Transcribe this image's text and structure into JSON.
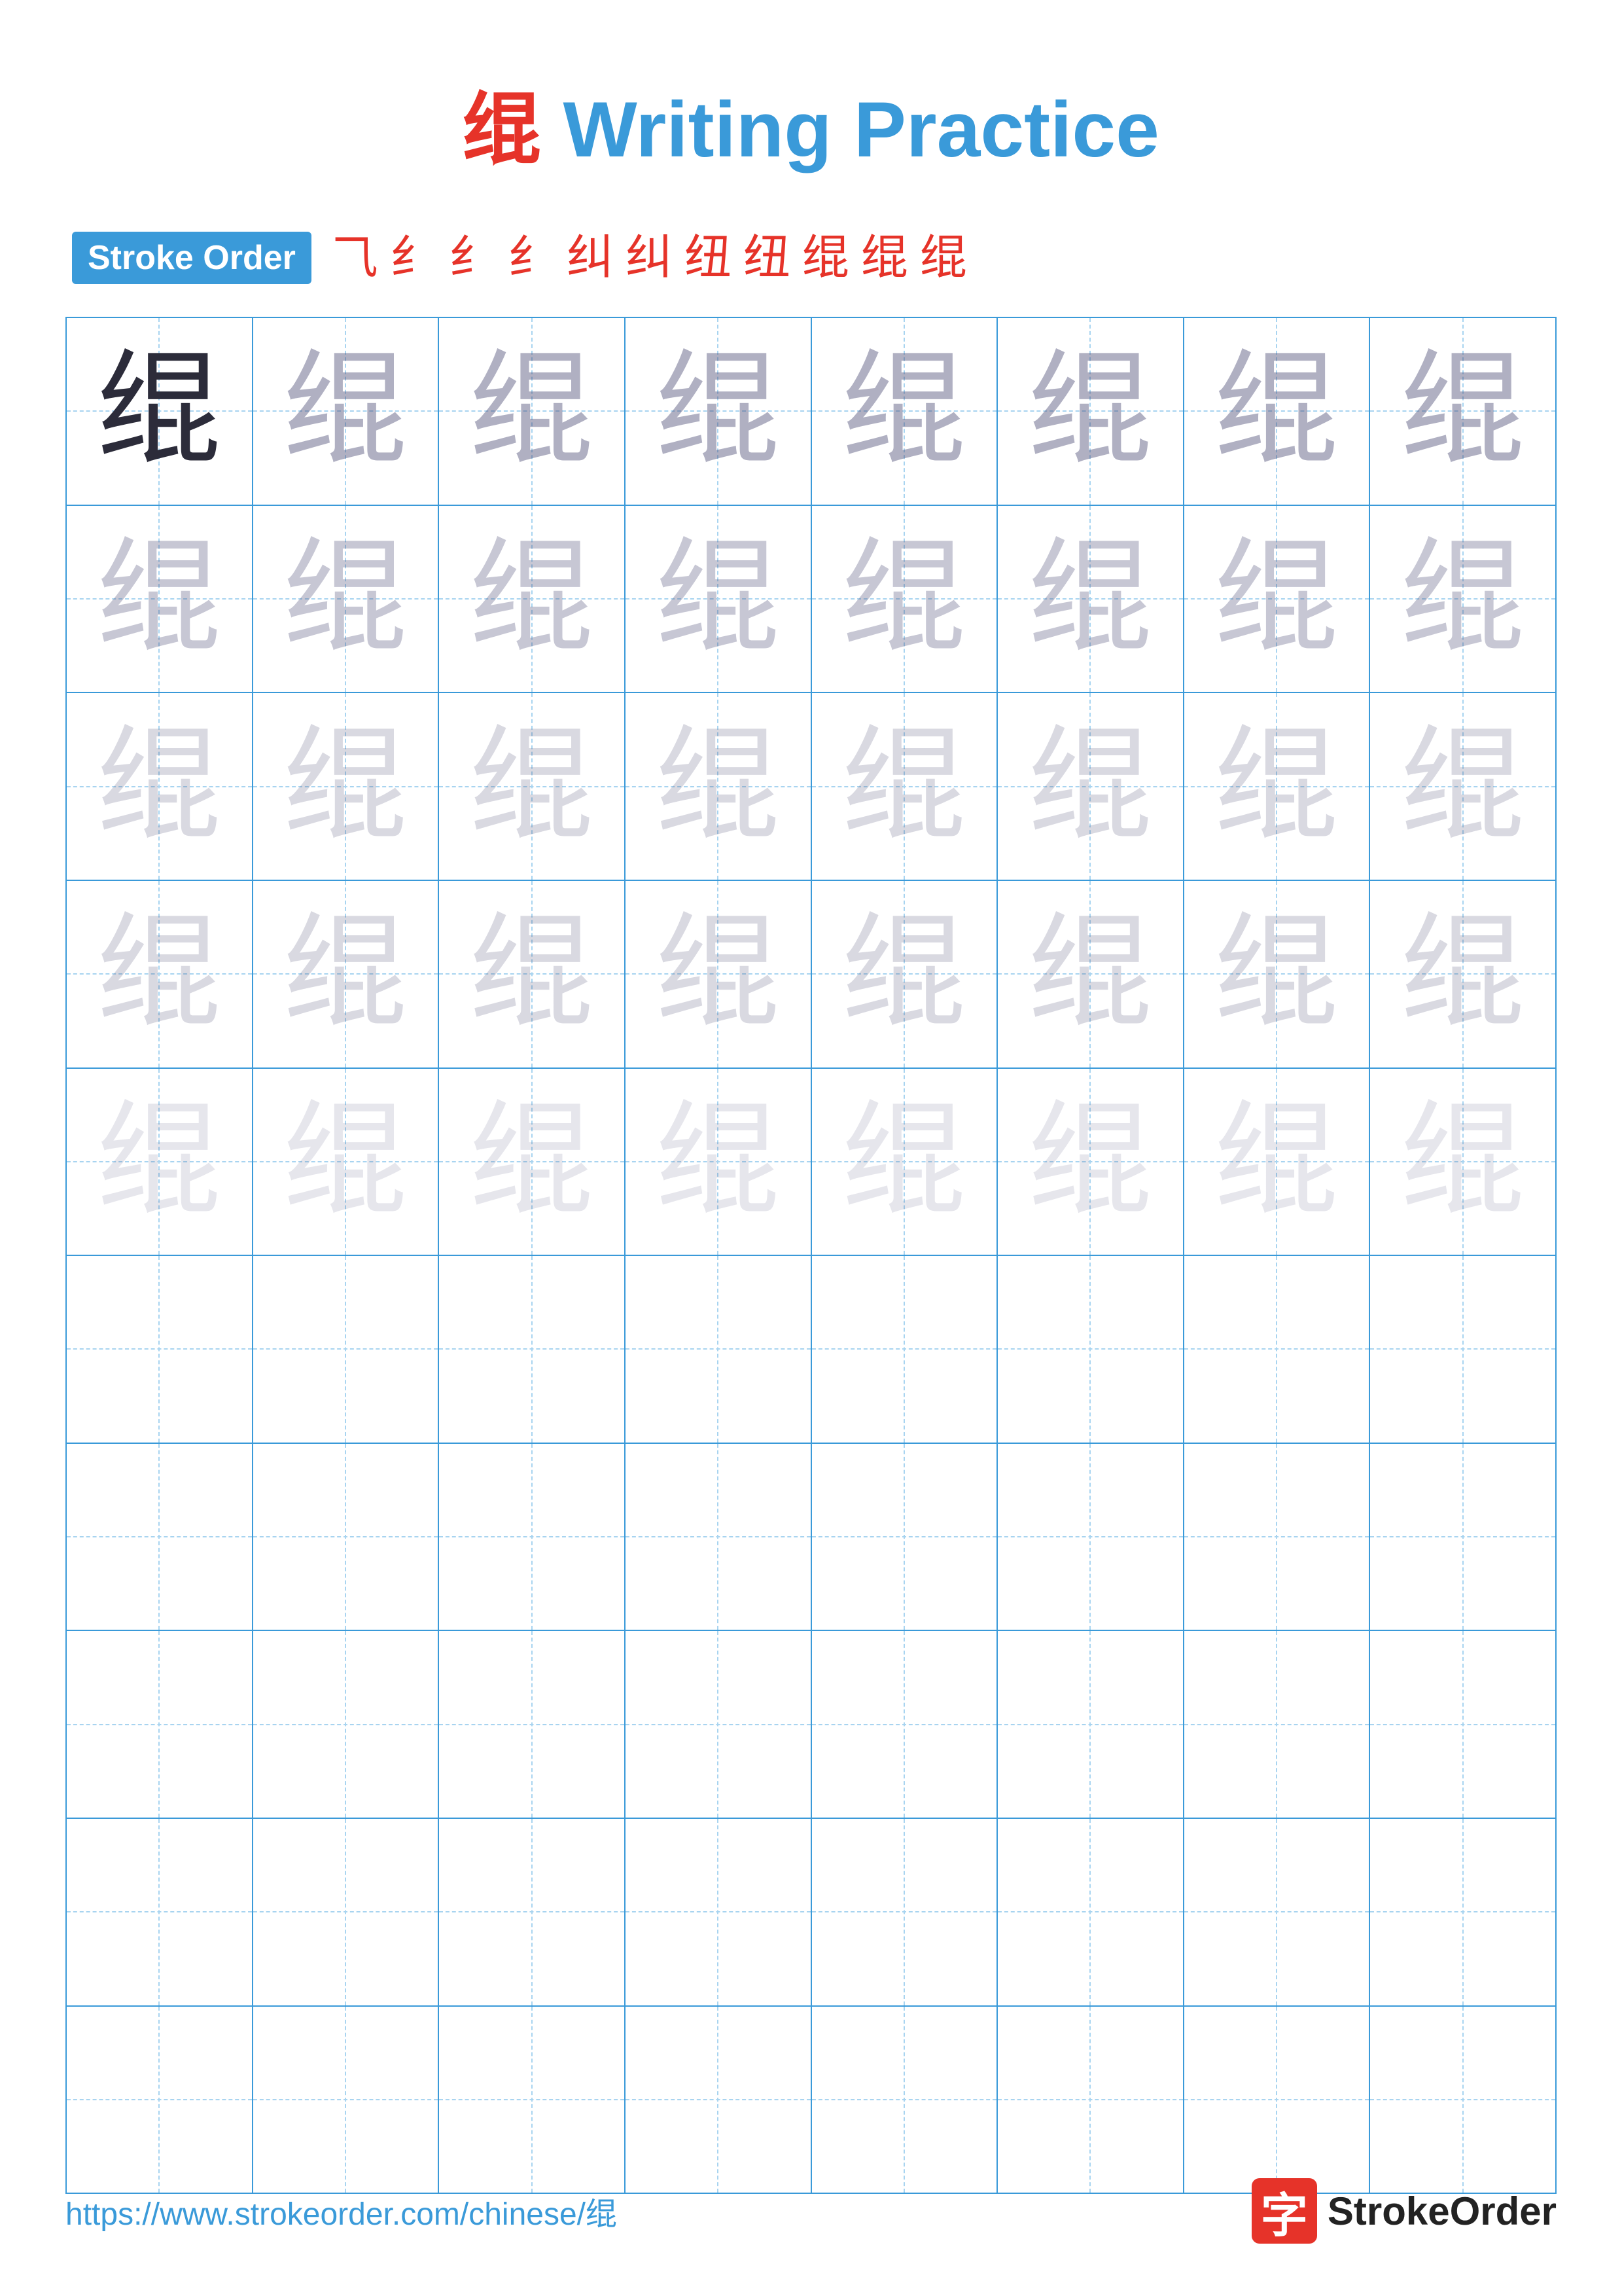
{
  "title": {
    "chinese": "绲",
    "english": " Writing Practice"
  },
  "stroke_order": {
    "label": "Stroke Order",
    "strokes": [
      "⺄",
      "纟",
      "纟",
      "纟",
      "纠",
      "纠",
      "纽",
      "纽",
      "绲",
      "绲",
      "绲"
    ]
  },
  "character": "绲",
  "grid": {
    "rows": 10,
    "cols": 8,
    "practice_rows_with_chars": 5,
    "empty_rows": 5
  },
  "footer": {
    "url": "https://www.strokeorder.com/chinese/绲",
    "logo_char": "字",
    "logo_text": "StrokeOrder"
  }
}
